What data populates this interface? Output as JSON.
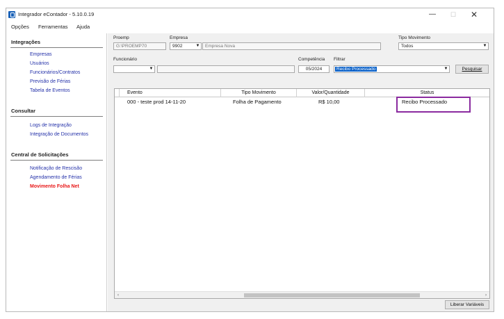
{
  "window": {
    "title": "Integrador eContador - 5.10.0.19",
    "min_label": "—",
    "max_label": "☐",
    "close_label": "✕"
  },
  "menu": {
    "items": [
      "Opções",
      "Ferramentas",
      "Ajuda"
    ]
  },
  "sidebar": {
    "sections": [
      {
        "title": "Integrações",
        "items": [
          "Empresas",
          "Usuários",
          "Funcionários/Contratos",
          "Previsão de Férias",
          "Tabela de Eventos"
        ]
      },
      {
        "title": "Consultar",
        "items": [
          "Logs de Integração",
          "Integração de Documentos"
        ]
      },
      {
        "title": "Central de Solicitações",
        "items": [
          "Notificação de Rescisão",
          "Agendamento de Férias",
          "Movimento Folha Net"
        ]
      }
    ],
    "active_item": "Movimento Folha Net",
    "active_color": "#e81818",
    "link_color": "#2431a9"
  },
  "filters": {
    "proemp_label": "Proemp",
    "proemp_value": "G:\\PROEMP70",
    "empresa_label": "Empresa",
    "empresa_code": "9902",
    "empresa_name": "Empresa Nova",
    "tipo_movimento_label": "Tipo Movimento",
    "tipo_movimento_value": "Todos",
    "funcionario_label": "Funcionário",
    "funcionario_value": "",
    "competencia_label": "Competência",
    "competencia_value": "05/2024",
    "filtrar_label": "Filtrar",
    "filtrar_value": "Recibo Processado",
    "pesquisar_label": "Pesquisar",
    "dropdown_icon": "chevron-down-icon"
  },
  "grid": {
    "columns": [
      "Evento",
      "Tipo Movimento",
      "Valor/Quantidade",
      "Status"
    ],
    "rows": [
      {
        "evento": "000 - teste prod 14-11-20",
        "tipo": "Folha de Pagamento",
        "valor": "R$ 10,00",
        "status": "Recibo Processado"
      }
    ],
    "scroll_left": "‹",
    "scroll_right": "›"
  },
  "footer": {
    "liberar_label": "Liberar Variáveis"
  },
  "colors": {
    "selection": "#0a61c9",
    "highlight_box": "#8a2a9f"
  }
}
